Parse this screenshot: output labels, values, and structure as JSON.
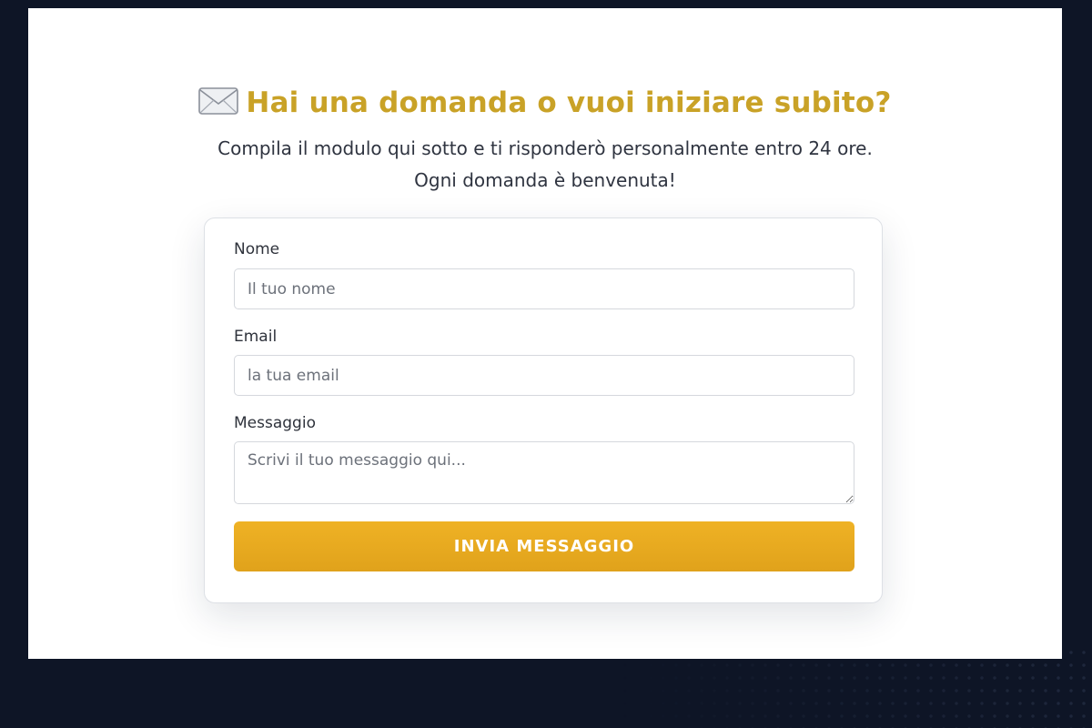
{
  "heading": {
    "icon": "envelope-icon",
    "text": "Hai una domanda o vuoi iniziare subito?",
    "color": "#c9a227"
  },
  "subtitle": {
    "line1": "Compila il modulo qui sotto e ti risponderò personalmente entro 24 ore.",
    "line2": "Ogni domanda è benvenuta!"
  },
  "form": {
    "name_label": "Nome",
    "name_placeholder": "Il tuo nome",
    "email_label": "Email",
    "email_placeholder": "la tua email",
    "message_label": "Messaggio",
    "message_placeholder": "Scrivi il tuo messaggio qui...",
    "submit_label": "INVIA MESSAGGIO",
    "submit_color": "#e6a820"
  }
}
